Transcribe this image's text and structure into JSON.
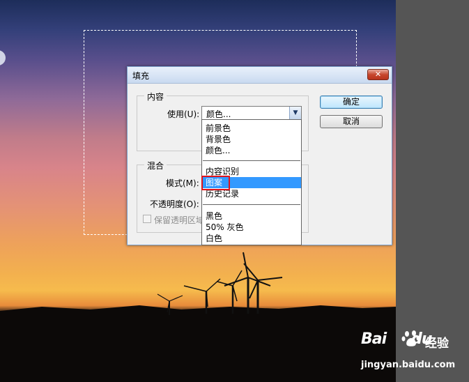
{
  "dialog": {
    "title": "填充",
    "close_symbol": "✕",
    "content_group": {
      "legend": "内容",
      "use_label": "使用(U):",
      "use_value": "颜色..."
    },
    "blend_group": {
      "legend": "混合",
      "mode_label": "模式(M):",
      "opacity_label": "不透明度(O):",
      "preserve_label": "保留透明区域"
    },
    "ok_label": "确定",
    "cancel_label": "取消"
  },
  "dropdown": {
    "groups": [
      [
        "前景色",
        "背景色",
        "颜色..."
      ],
      [
        "内容识别",
        "图案",
        "历史记录"
      ],
      [
        "黑色",
        "50% 灰色",
        "白色"
      ]
    ],
    "selected": "图案"
  },
  "watermark": {
    "brand": "Bai",
    "brand_suffix": "du",
    "jingyan": "经验",
    "url": "jingyan.baidu.com"
  },
  "colors": {
    "selection_highlight": "#3399ff",
    "annotation_box": "#e0141a"
  },
  "icons": {
    "dropdown_arrow": "chevron-down-icon",
    "close": "close-icon",
    "watermark": "baidu-paw-icon"
  }
}
